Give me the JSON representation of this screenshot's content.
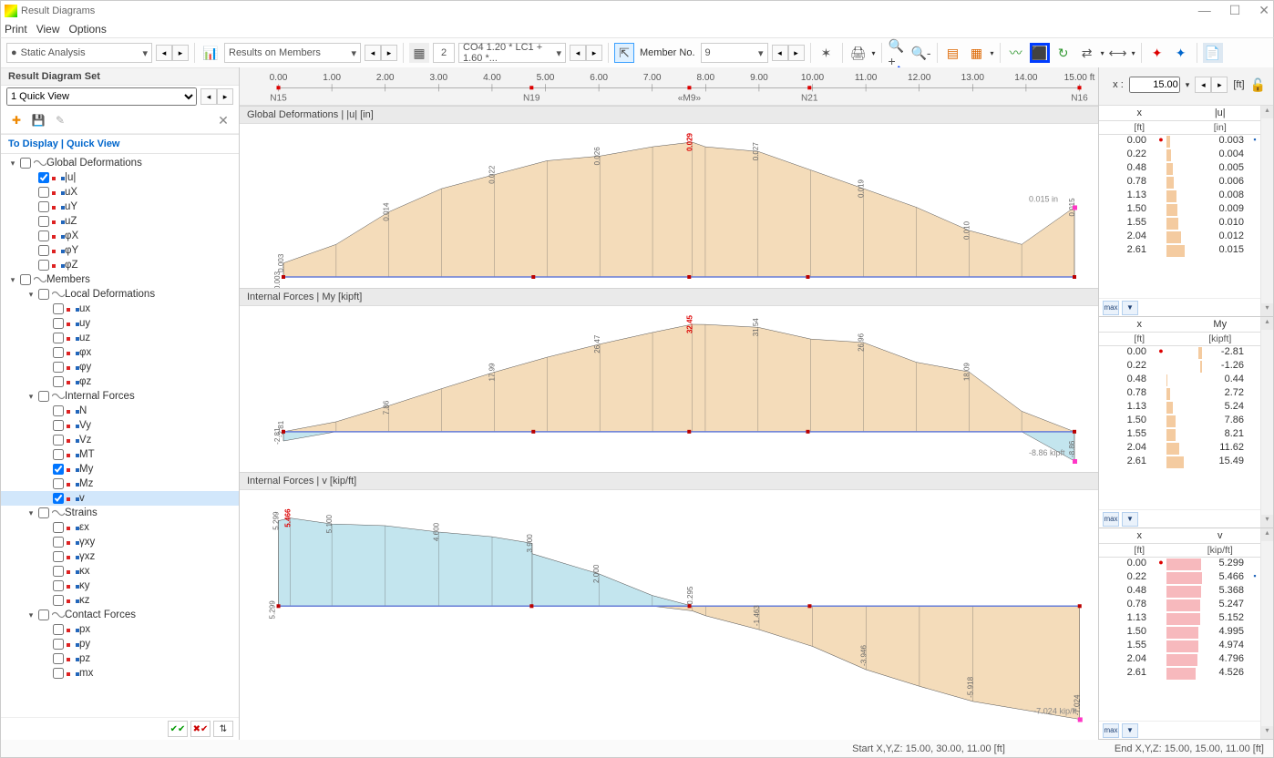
{
  "window": {
    "title": "Result Diagrams"
  },
  "menubar": [
    "Print",
    "View",
    "Options"
  ],
  "toolbar": {
    "analysis": "Static Analysis",
    "results_on": "Results on Members",
    "co_num": "2",
    "co_text": "CO4  1.20 * LC1 + 1.60 *...",
    "member_label": "Member No.",
    "member_val": "9"
  },
  "left": {
    "set_header": "Result Diagram Set",
    "quickview_select": "1  Quick View",
    "to_display": "To Display | Quick View",
    "tree": [
      {
        "lvl": 0,
        "exp": true,
        "chk": false,
        "type": "group",
        "label": "Global Deformations"
      },
      {
        "lvl": 1,
        "chk": true,
        "type": "leaf",
        "label": "|u|"
      },
      {
        "lvl": 1,
        "chk": false,
        "type": "leaf",
        "label": "uX"
      },
      {
        "lvl": 1,
        "chk": false,
        "type": "leaf",
        "label": "uY"
      },
      {
        "lvl": 1,
        "chk": false,
        "type": "leaf",
        "label": "uZ"
      },
      {
        "lvl": 1,
        "chk": false,
        "type": "leaf",
        "label": "φX"
      },
      {
        "lvl": 1,
        "chk": false,
        "type": "leaf",
        "label": "φY"
      },
      {
        "lvl": 1,
        "chk": false,
        "type": "leaf",
        "label": "φZ"
      },
      {
        "lvl": 0,
        "exp": true,
        "chk": false,
        "type": "group",
        "label": "Members"
      },
      {
        "lvl": 1,
        "exp": true,
        "chk": false,
        "type": "group",
        "label": "Local Deformations"
      },
      {
        "lvl": 2,
        "chk": false,
        "type": "leaf",
        "label": "ux"
      },
      {
        "lvl": 2,
        "chk": false,
        "type": "leaf",
        "label": "uy"
      },
      {
        "lvl": 2,
        "chk": false,
        "type": "leaf",
        "label": "uz"
      },
      {
        "lvl": 2,
        "chk": false,
        "type": "leaf",
        "label": "φx"
      },
      {
        "lvl": 2,
        "chk": false,
        "type": "leaf",
        "label": "φy"
      },
      {
        "lvl": 2,
        "chk": false,
        "type": "leaf",
        "label": "φz"
      },
      {
        "lvl": 1,
        "exp": true,
        "chk": false,
        "type": "group",
        "label": "Internal Forces"
      },
      {
        "lvl": 2,
        "chk": false,
        "type": "leaf",
        "label": "N"
      },
      {
        "lvl": 2,
        "chk": false,
        "type": "leaf",
        "label": "Vy"
      },
      {
        "lvl": 2,
        "chk": false,
        "type": "leaf",
        "label": "Vz"
      },
      {
        "lvl": 2,
        "chk": false,
        "type": "leaf",
        "label": "MT"
      },
      {
        "lvl": 2,
        "chk": true,
        "type": "leaf",
        "label": "My"
      },
      {
        "lvl": 2,
        "chk": false,
        "type": "leaf",
        "label": "Mz"
      },
      {
        "lvl": 2,
        "chk": true,
        "type": "leaf",
        "label": "v",
        "sel": true
      },
      {
        "lvl": 1,
        "exp": true,
        "chk": false,
        "type": "group",
        "label": "Strains"
      },
      {
        "lvl": 2,
        "chk": false,
        "type": "leaf",
        "label": "εx"
      },
      {
        "lvl": 2,
        "chk": false,
        "type": "leaf",
        "label": "γxy"
      },
      {
        "lvl": 2,
        "chk": false,
        "type": "leaf",
        "label": "γxz"
      },
      {
        "lvl": 2,
        "chk": false,
        "type": "leaf",
        "label": "κx"
      },
      {
        "lvl": 2,
        "chk": false,
        "type": "leaf",
        "label": "κy"
      },
      {
        "lvl": 2,
        "chk": false,
        "type": "leaf",
        "label": "κz"
      },
      {
        "lvl": 1,
        "exp": true,
        "chk": false,
        "type": "group",
        "label": "Contact Forces"
      },
      {
        "lvl": 2,
        "chk": false,
        "type": "leaf",
        "label": "px"
      },
      {
        "lvl": 2,
        "chk": false,
        "type": "leaf",
        "label": "py"
      },
      {
        "lvl": 2,
        "chk": false,
        "type": "leaf",
        "label": "pz"
      },
      {
        "lvl": 2,
        "chk": false,
        "type": "leaf",
        "label": "mx"
      }
    ]
  },
  "ruler": {
    "ticks": [
      "0.00",
      "1.00",
      "2.00",
      "3.00",
      "4.00",
      "5.00",
      "6.00",
      "7.00",
      "8.00",
      "9.00",
      "10.00",
      "11.00",
      "12.00",
      "13.00",
      "14.00",
      "15.00 ft"
    ],
    "nodes": [
      {
        "pos": 0.0,
        "label": "N15"
      },
      {
        "pos": 0.316,
        "label": "N19"
      },
      {
        "pos": 0.513,
        "label": "«M9»"
      },
      {
        "pos": 0.663,
        "label": "N21"
      },
      {
        "pos": 1.0,
        "label": "N16"
      }
    ],
    "x_label": "x :",
    "x_value": "15.00",
    "x_unit": "[ft]"
  },
  "charts": [
    {
      "title": "Global Deformations | |u| [in]",
      "annot_right": "0.015 in",
      "left_val": "0.003"
    },
    {
      "title": "Internal Forces | My [kipft]",
      "annot_right": "-8.86 kipft",
      "left_val": "-2.81"
    },
    {
      "title": "Internal Forces | v [kip/ft]",
      "annot_right": "-7.024 kip/ft",
      "left_val": "5.299"
    }
  ],
  "chart_data": [
    {
      "type": "area",
      "title": "Global Deformations |u|",
      "x_unit": "ft",
      "y_unit": "in",
      "x": [
        0,
        1,
        2,
        3,
        4,
        5,
        6,
        7,
        7.75,
        8,
        9,
        10,
        11,
        12,
        13,
        14,
        15
      ],
      "y": [
        0.003,
        0.007,
        0.014,
        0.019,
        0.022,
        0.025,
        0.026,
        0.028,
        0.029,
        0.028,
        0.027,
        0.023,
        0.019,
        0.015,
        0.01,
        0.007,
        0.015
      ],
      "max_label": "0.029",
      "max_x": 7.75,
      "right_marker": 0.015
    },
    {
      "type": "area",
      "title": "Internal Forces My",
      "x_unit": "ft",
      "y_unit": "kipft",
      "x": [
        0,
        1,
        2,
        3,
        4,
        5,
        6,
        7,
        7.75,
        8,
        9,
        10,
        11,
        12,
        13,
        14,
        15
      ],
      "y": [
        -2.81,
        3.0,
        7.86,
        13.0,
        17.99,
        22.5,
        26.47,
        30.0,
        32.45,
        32.41,
        31.54,
        28.0,
        26.96,
        21.0,
        18.09,
        6.19,
        -8.86
      ],
      "max_label": "32.45",
      "max_x": 7.75,
      "right_marker": -8.86
    },
    {
      "type": "area",
      "title": "Internal Forces v",
      "x_unit": "ft",
      "y_unit": "kip/ft",
      "x": [
        0,
        0.22,
        1,
        2,
        3,
        4,
        4.75,
        4.75,
        6,
        7,
        7.75,
        8,
        9,
        10,
        11,
        12,
        13,
        15
      ],
      "y": [
        5.299,
        5.466,
        5.1,
        4.995,
        4.6,
        4.31,
        3.9,
        3.252,
        2.0,
        0.66,
        -0.295,
        -0.6,
        -1.463,
        -2.5,
        -3.946,
        -4.977,
        -5.918,
        -7.024
      ],
      "max_label": "5.466",
      "max_x": 0.22
    }
  ],
  "right": {
    "sections": [
      {
        "h1": "x",
        "h2": "|u|",
        "u1": "[ft]",
        "u2": "[in]",
        "color": "beige",
        "rows": [
          {
            "x": "0.00",
            "flag": "●",
            "v": "0.003",
            "bar": 0.1,
            "rflag": true
          },
          {
            "x": "0.22",
            "v": "0.004",
            "bar": 0.13
          },
          {
            "x": "0.48",
            "v": "0.005",
            "bar": 0.17
          },
          {
            "x": "0.78",
            "v": "0.006",
            "bar": 0.2
          },
          {
            "x": "1.13",
            "v": "0.008",
            "bar": 0.27
          },
          {
            "x": "1.50",
            "v": "0.009",
            "bar": 0.3
          },
          {
            "x": "1.55",
            "v": "0.010",
            "bar": 0.34
          },
          {
            "x": "2.04",
            "v": "0.012",
            "bar": 0.4
          },
          {
            "x": "2.61",
            "v": "0.015",
            "bar": 0.5
          }
        ]
      },
      {
        "h1": "x",
        "h2": "My",
        "u1": "[ft]",
        "u2": "[kipft]",
        "color": "beige",
        "rows": [
          {
            "x": "0.00",
            "flag": "●",
            "v": "-2.81",
            "bar": -0.09
          },
          {
            "x": "0.22",
            "v": "-1.26",
            "bar": -0.04
          },
          {
            "x": "0.48",
            "v": "0.44",
            "bar": 0.02
          },
          {
            "x": "0.78",
            "v": "2.72",
            "bar": 0.09
          },
          {
            "x": "1.13",
            "v": "5.24",
            "bar": 0.17
          },
          {
            "x": "1.50",
            "v": "7.86",
            "bar": 0.25
          },
          {
            "x": "1.55",
            "v": "8.21",
            "bar": 0.26
          },
          {
            "x": "2.04",
            "v": "11.62",
            "bar": 0.37
          },
          {
            "x": "2.61",
            "v": "15.49",
            "bar": 0.49
          }
        ]
      },
      {
        "h1": "x",
        "h2": "v",
        "u1": "[ft]",
        "u2": "[kip/ft]",
        "color": "pink",
        "rows": [
          {
            "x": "0.00",
            "flag": "●",
            "v": "5.299",
            "bar": 0.97
          },
          {
            "x": "0.22",
            "v": "5.466",
            "bar": 1.0,
            "rflag": true
          },
          {
            "x": "0.48",
            "v": "5.368",
            "bar": 0.98
          },
          {
            "x": "0.78",
            "v": "5.247",
            "bar": 0.96
          },
          {
            "x": "1.13",
            "v": "5.152",
            "bar": 0.94
          },
          {
            "x": "1.50",
            "v": "4.995",
            "bar": 0.91
          },
          {
            "x": "1.55",
            "v": "4.974",
            "bar": 0.91
          },
          {
            "x": "2.04",
            "v": "4.796",
            "bar": 0.88
          },
          {
            "x": "2.61",
            "v": "4.526",
            "bar": 0.83
          }
        ]
      }
    ]
  },
  "status": {
    "left": "Start X,Y,Z: 15.00, 30.00, 11.00 [ft]",
    "right": "End X,Y,Z: 15.00, 15.00, 11.00 [ft]"
  }
}
